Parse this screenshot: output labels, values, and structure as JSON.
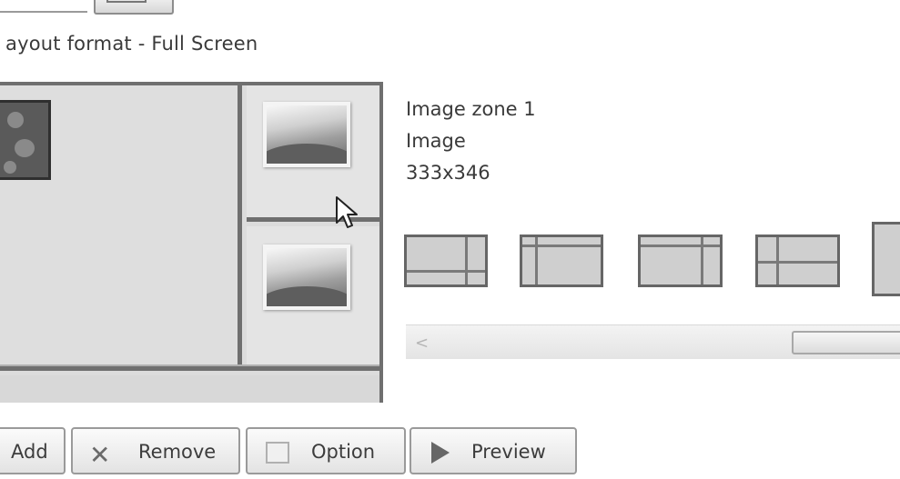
{
  "layout": {
    "title": "ayout format - Full Screen"
  },
  "zone": {
    "name": "Image zone 1",
    "type": "Image",
    "size": "333x346"
  },
  "scrollbar": {
    "left_arrow": "<"
  },
  "buttons": {
    "add": "Add",
    "remove": "Remove",
    "option": "Option",
    "preview": "Preview"
  },
  "icons": {
    "remove": "x-icon",
    "option": "option-icon",
    "preview": "play-icon",
    "cursor": "mouse-pointer-icon"
  },
  "colors": {
    "frame": "#6f6f6f",
    "zone_fill": "#dedede",
    "button_border": "#9a9a9a"
  }
}
